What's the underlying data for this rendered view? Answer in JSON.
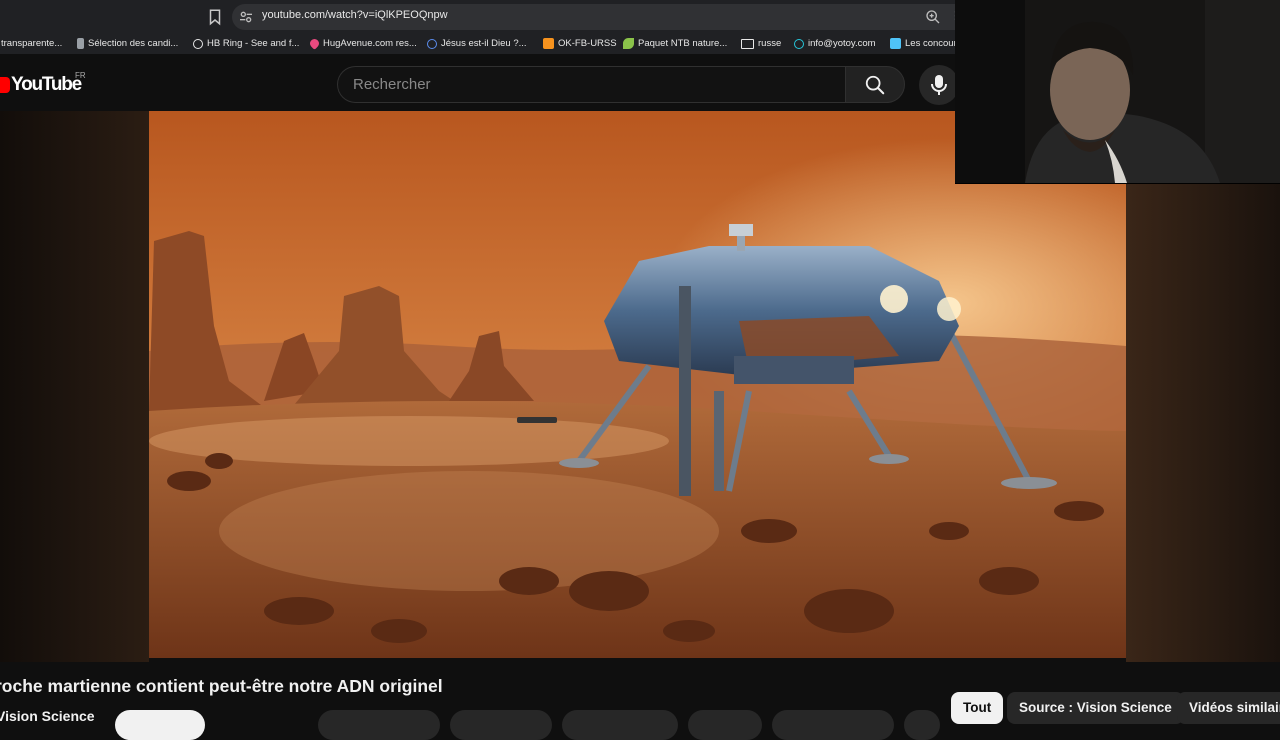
{
  "browser": {
    "url": "youtube.com/watch?v=iQlKPEOQnpw",
    "url_more": "⋮",
    "bookmarks": [
      {
        "label": "transparente...",
        "icon": "doc-icon",
        "color": "#5b8def"
      },
      {
        "label": "Sélection des candi...",
        "icon": "doc-icon",
        "color": "#9aa0a6"
      },
      {
        "label": "HB Ring - See and f...",
        "icon": "globe-icon",
        "color": "#e8e8e8"
      },
      {
        "label": "HugAvenue.com res...",
        "icon": "heart-icon",
        "color": "#e84a7f"
      },
      {
        "label": "Jésus est-il Dieu ?...",
        "icon": "info-icon",
        "color": "#5b8def"
      },
      {
        "label": "OK-FB-URSS",
        "icon": "ok-icon",
        "color": "#f7931e"
      },
      {
        "label": "Paquet NTB nature...",
        "icon": "leaf-icon",
        "color": "#8bc34a"
      },
      {
        "label": "russe",
        "icon": "folder-icon",
        "color": "#e8e8e8"
      },
      {
        "label": "info@yotoy.com",
        "icon": "mail-icon",
        "color": "#26c6da"
      },
      {
        "label": "Les concours",
        "icon": "image-icon",
        "color": "#4fc3f7"
      }
    ]
  },
  "youtube": {
    "logo": "YouTube",
    "region": "FR",
    "search_placeholder": "Rechercher",
    "brand_red": "#ff0000"
  },
  "video": {
    "title": "roche martienne contient peut-être notre ADN originel",
    "channel": "Vision Science"
  },
  "chips": [
    "Tout",
    "Source : Vision Science",
    "Vidéos similaire"
  ]
}
